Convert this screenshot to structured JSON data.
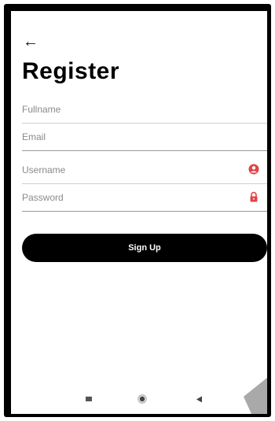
{
  "header": {
    "back_icon": "arrow-left-icon",
    "title": "Register"
  },
  "form": {
    "fullname": {
      "placeholder": "Fullname",
      "value": ""
    },
    "email": {
      "placeholder": "Email",
      "value": ""
    },
    "username": {
      "placeholder": "Username",
      "value": "",
      "icon": "user-circle-icon"
    },
    "password": {
      "placeholder": "Password",
      "value": "",
      "icon": "lock-icon"
    },
    "submit_label": "Sign Up"
  },
  "navbar": {
    "icons": [
      "square-recents-icon",
      "circle-home-icon",
      "triangle-back-icon"
    ]
  },
  "colors": {
    "accent": "#e04448",
    "button": "#000000",
    "button_text": "#ffffff",
    "frame": "#000000"
  }
}
